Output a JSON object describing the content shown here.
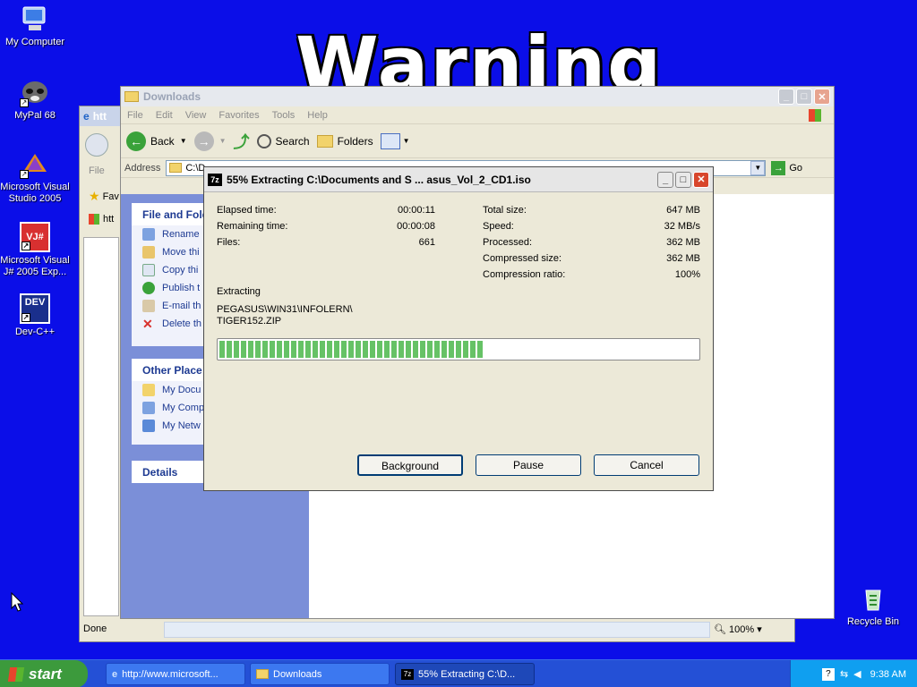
{
  "desktop": {
    "warning_text": "Warning",
    "icons": [
      {
        "label": "My Computer",
        "icon": "my-computer-icon"
      },
      {
        "label": "MyPal 68",
        "icon": "mypal-icon"
      },
      {
        "label": "Microsoft Visual Studio 2005",
        "icon": "visual-studio-icon"
      },
      {
        "label": "Microsoft Visual J# 2005 Exp...",
        "icon": "visual-jsharp-icon"
      },
      {
        "label": "Dev-C++",
        "icon": "dev-cpp-icon"
      },
      {
        "label": "Recycle Bin",
        "icon": "recycle-bin-icon"
      }
    ],
    "dev_badge": "DEV",
    "vj_badge": "VJ#"
  },
  "ie_window": {
    "title": "htt",
    "menu_file": "File",
    "favorites": "Fav",
    "tab": "htt",
    "status": "Done",
    "zoom": "100%"
  },
  "explorer": {
    "title": "Downloads",
    "menu": [
      "File",
      "Edit",
      "View",
      "Favorites",
      "Tools",
      "Help"
    ],
    "toolbar": {
      "back": "Back",
      "search": "Search",
      "folders": "Folders"
    },
    "address_label": "Address",
    "address_value": "C:\\D",
    "go": "Go",
    "file_tasks": {
      "title": "File and Fold",
      "items": [
        "Rename",
        "Move thi",
        "Copy thi",
        "Publish t",
        "E-mail th",
        "Delete th"
      ]
    },
    "other_places": {
      "title": "Other Place",
      "items": [
        "My Docu",
        "My Comp",
        "My Netw"
      ]
    },
    "details": "Details"
  },
  "extract_dialog": {
    "title": "55% Extracting C:\\Documents and S ... asus_Vol_2_CD1.iso",
    "app_badge": "7z",
    "left": [
      {
        "label": "Elapsed time:",
        "value": "00:00:11"
      },
      {
        "label": "Remaining time:",
        "value": "00:00:08"
      },
      {
        "label": "Files:",
        "value": "661"
      }
    ],
    "right": [
      {
        "label": "Total size:",
        "value": "647 MB"
      },
      {
        "label": "Speed:",
        "value": "32 MB/s"
      },
      {
        "label": "Processed:",
        "value": "362 MB"
      },
      {
        "label": "Compressed size:",
        "value": "362 MB"
      },
      {
        "label": "Compression ratio:",
        "value": "100%"
      }
    ],
    "status_label": "Extracting",
    "current_path_line1": "PEGASUS\\WIN31\\INFOLERN\\",
    "current_path_line2": "TIGER152.ZIP",
    "progress": 0.55,
    "buttons": {
      "background": "Background",
      "pause": "Pause",
      "cancel": "Cancel"
    }
  },
  "taskbar": {
    "start": "start",
    "tasks": [
      {
        "label": "http://www.microsoft..."
      },
      {
        "label": "Downloads"
      },
      {
        "label": "55% Extracting C:\\D..."
      }
    ],
    "clock": "9:38 AM"
  },
  "colors": {
    "desktop": "#0b0ee8",
    "progress_fill": "#5fb85f",
    "taskbar": "#2450d6",
    "start": "#3c9a3c",
    "close": "#d8462c"
  }
}
